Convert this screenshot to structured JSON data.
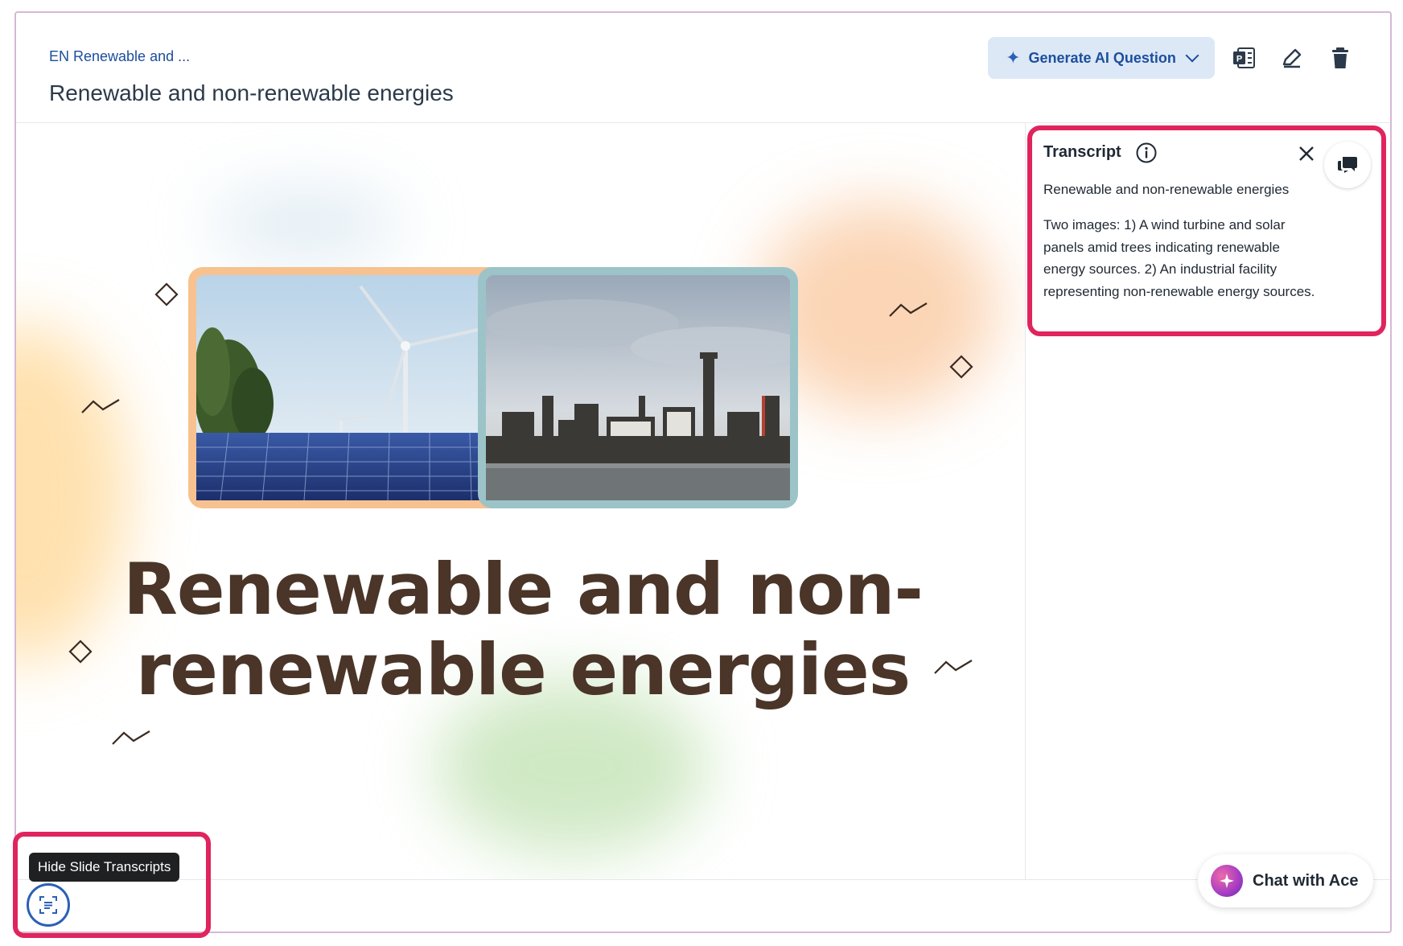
{
  "header": {
    "breadcrumb": "EN Renewable and ...",
    "title": "Renewable and non-renewable energies",
    "generate_label": "Generate AI Question"
  },
  "toolbar": {
    "powerpoint_icon": "powerpoint-icon",
    "edit_icon": "pencil-icon",
    "delete_icon": "trash-icon"
  },
  "slide": {
    "title_line1": "Renewable and non-",
    "title_line2": "renewable energies",
    "images": [
      "wind-turbine-solar-panels-image",
      "industrial-facility-image"
    ]
  },
  "transcript": {
    "title": "Transcript",
    "heading": "Renewable and non-renewable energies",
    "body": "Two images: 1) A wind turbine and solar panels amid trees indicating renewable energy sources. 2) An industrial facility representing non-renewable energy sources."
  },
  "transcript_toggle": {
    "tooltip": "Hide Slide Transcripts"
  },
  "chat": {
    "label": "Chat with Ace"
  },
  "colors": {
    "accent": "#1c4f9c",
    "highlight": "#e0245e",
    "slide_title": "#4a3528",
    "frame_orange": "#f7c28f",
    "frame_teal": "#9cc4c8"
  }
}
